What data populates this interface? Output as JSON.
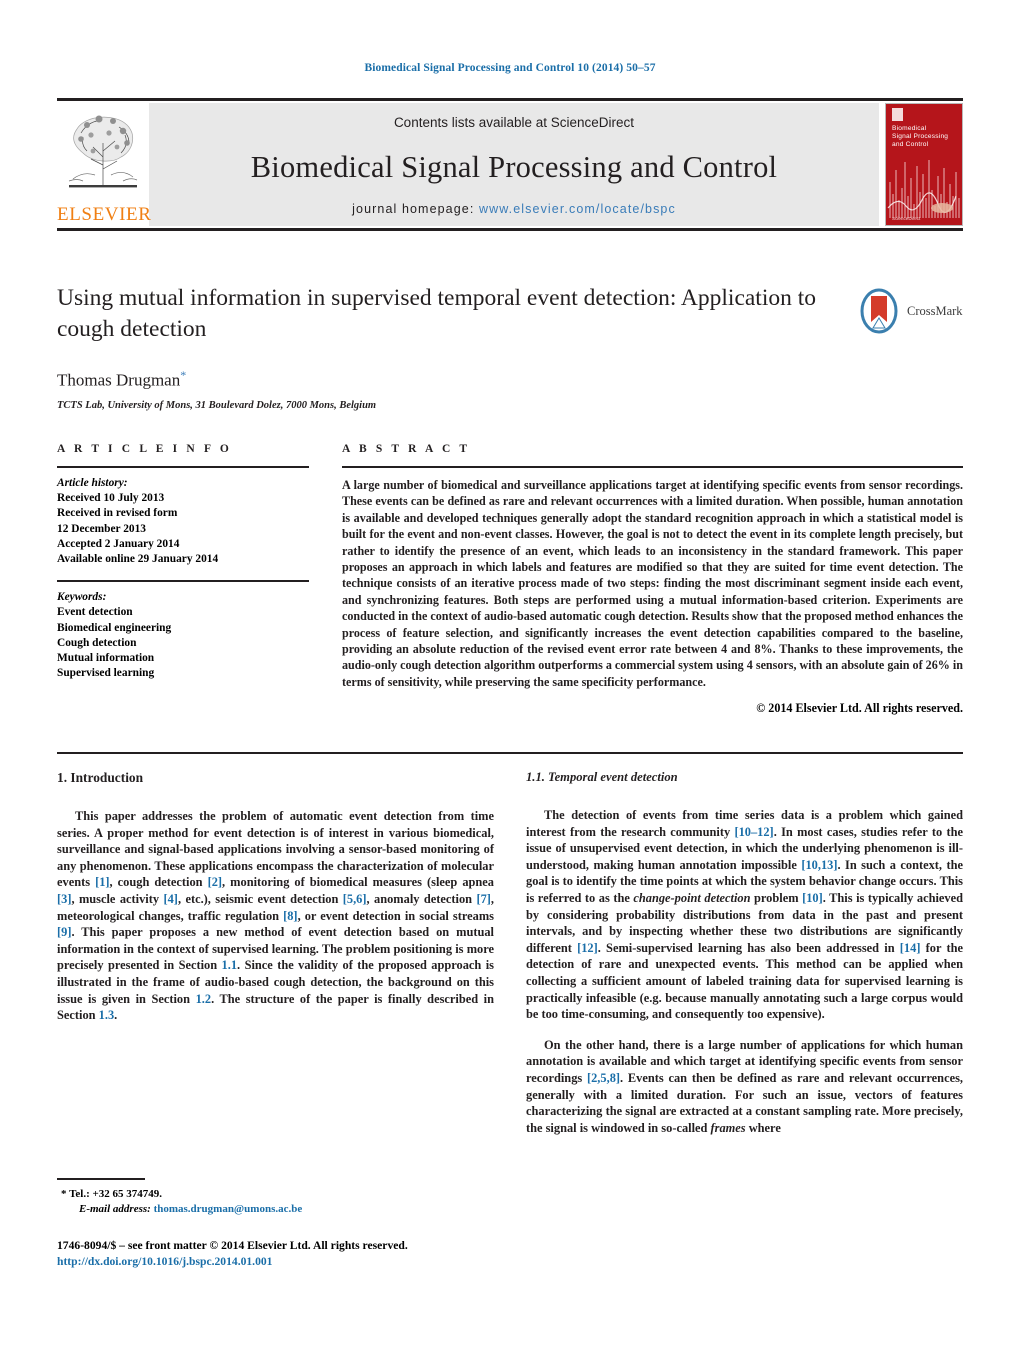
{
  "running_head": "Biomedical Signal Processing and Control 10 (2014) 50–57",
  "masthead": {
    "contents_prefix": "Contents lists available at ",
    "sciencedirect_link": "ScienceDirect",
    "journal_title": "Biomedical Signal Processing and Control",
    "homepage_label": "journal homepage:",
    "homepage_url": "www.elsevier.com/locate/bspc",
    "publisher_wordmark": "ELSEVIER",
    "cover": {
      "title_line1": "Biomedical",
      "title_line2": "Signal Processing",
      "title_line3": "and Control",
      "footer": "ScienceDirect"
    }
  },
  "title_block": {
    "title": "Using mutual information in supervised temporal event detection: Application to cough detection",
    "crossmark_label": "CrossMark",
    "author": "Thomas Drugman",
    "author_marker": "*",
    "affiliation": "TCTS Lab, University of Mons, 31 Boulevard Dolez, 7000 Mons, Belgium"
  },
  "article_info": {
    "section_label": "A R T I C L E   I N F O",
    "history_heading": "Article history:",
    "history_lines": [
      "Received 10 July 2013",
      "Received in revised form",
      "12 December 2013",
      "Accepted 2 January 2014",
      "Available online 29 January 2014"
    ],
    "keywords_heading": "Keywords:",
    "keywords": [
      "Event detection",
      "Biomedical engineering",
      "Cough detection",
      "Mutual information",
      "Supervised learning"
    ]
  },
  "abstract": {
    "section_label": "A B S T R A C T",
    "text": "A large number of biomedical and surveillance applications target at identifying specific events from sensor recordings. These events can be defined as rare and relevant occurrences with a limited duration. When possible, human annotation is available and developed techniques generally adopt the standard recognition approach in which a statistical model is built for the event and non-event classes. However, the goal is not to detect the event in its complete length precisely, but rather to identify the presence of an event, which leads to an inconsistency in the standard framework. This paper proposes an approach in which labels and features are modified so that they are suited for time event detection. The technique consists of an iterative process made of two steps: finding the most discriminant segment inside each event, and synchronizing features. Both steps are performed using a mutual information-based criterion. Experiments are conducted in the context of audio-based automatic cough detection. Results show that the proposed method enhances the process of feature selection, and significantly increases the event detection capabilities compared to the baseline, providing an absolute reduction of the revised event error rate between 4 and 8%. Thanks to these improvements, the audio-only cough detection algorithm outperforms a commercial system using 4 sensors, with an absolute gain of 26% in terms of sensitivity, while preserving the same specificity performance.",
    "copyright": "© 2014 Elsevier Ltd. All rights reserved."
  },
  "body": {
    "section1_title": "1.  Introduction",
    "section1_para1_a": "This paper addresses the problem of automatic event detection from time series. A proper method for event detection is of interest in various biomedical, surveillance and signal-based applications involving a sensor-based monitoring of any phenomenon. These applications encompass the characterization of molecular events ",
    "ref1": "[1]",
    "section1_para1_b": ", cough detection ",
    "ref2": "[2]",
    "section1_para1_c": ", monitoring of biomedical measures (sleep apnea ",
    "ref3": "[3]",
    "section1_para1_d": ", muscle activity ",
    "ref4": "[4]",
    "section1_para1_e": ", etc.), seismic event detection ",
    "ref56": "[5,6]",
    "section1_para1_f": ", anomaly detection ",
    "ref7": "[7]",
    "section1_para1_g": ", meteorological changes, traffic regulation ",
    "ref8": "[8]",
    "section1_para1_h": ", or event detection in social streams ",
    "ref9": "[9]",
    "section1_para1_i": ". This paper proposes a new method of event detection based on mutual information in the context of supervised learning. The problem positioning is more precisely presented in Section ",
    "sec_ref_11": "1.1",
    "section1_para1_j": ". Since the validity of the proposed approach is illustrated in the frame of audio-based cough detection, the background on this issue is given in Section ",
    "sec_ref_12": "1.2",
    "section1_para1_k": ". The structure of the paper is finally described in Section ",
    "sec_ref_13": "1.3",
    "section1_para1_l": ".",
    "subsection11_title": "1.1.  Temporal event detection",
    "r_para1_a": "The detection of events from time series data is a problem which gained interest from the research community ",
    "ref1012": "[10–12]",
    "r_para1_b": ". In most cases, studies refer to the issue of unsupervised event detection, in which the underlying phenomenon is ill-understood, making human annotation impossible ",
    "ref1013": "[10,13]",
    "r_para1_c": ". In such a context, the goal is to identify the time points at which the system behavior change occurs. This is referred to as the ",
    "changepoint_italic": "change-point detection",
    "r_para1_d": " problem ",
    "ref10": "[10]",
    "r_para1_e": ". This is typically achieved by considering probability distributions from data in the past and present intervals, and by inspecting whether these two distributions are significantly different ",
    "ref12": "[12]",
    "r_para1_f": ". Semi-supervised learning has also been addressed in ",
    "ref14": "[14]",
    "r_para1_g": " for the detection of rare and unexpected events. This method can be applied when collecting a sufficient amount of labeled training data for supervised learning is practically infeasible (e.g. because manually annotating such a large corpus would be too time-consuming, and consequently too expensive).",
    "r_para2_a": "On the other hand, there is a large number of applications for which human annotation is available and which target at identifying specific events from sensor recordings ",
    "ref258": "[2,5,8]",
    "r_para2_b": ". Events can then be defined as rare and relevant occurrences, generally with a limited duration. For such an issue, vectors of features characterizing the signal are extracted at a constant sampling rate. More precisely, the signal is windowed in so-called ",
    "frames_italic": "frames",
    "r_para2_c": " where"
  },
  "footnote": {
    "marker": "*",
    "tel": "Tel.: +32 65 374749.",
    "email_label": "E-mail address:",
    "email": "thomas.drugman@umons.ac.be"
  },
  "footer": {
    "front_matter": "1746-8094/$ – see front matter © 2014 Elsevier Ltd. All rights reserved.",
    "doi": "http://dx.doi.org/10.1016/j.bspc.2014.01.001"
  },
  "colors": {
    "link_blue": "#1a6ea8",
    "sciencedirect_blue": "#3a7cb8",
    "elsevier_orange": "#f07f13",
    "cover_red": "#b5151b",
    "ink": "#231f20"
  }
}
